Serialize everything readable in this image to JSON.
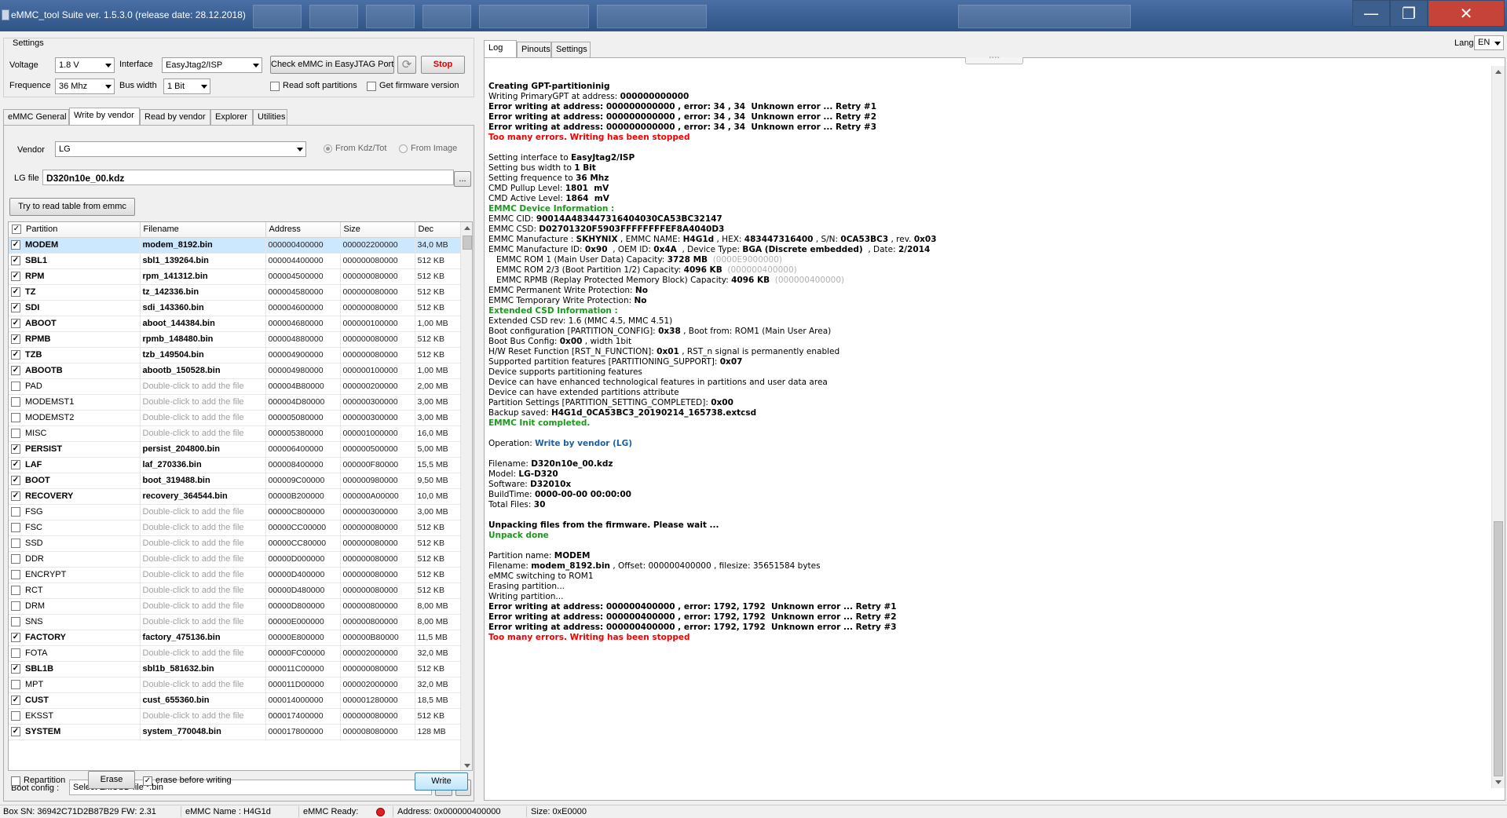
{
  "window": {
    "title": "eMMC_tool Suite  ver. 1.5.3.0 (release date: 28.12.2018)",
    "min": "—",
    "max": "❐",
    "close": "✕"
  },
  "settings": {
    "group_label": "Settings",
    "voltage_label": "Voltage",
    "voltage_value": "1.8 V",
    "interface_label": "Interface",
    "interface_value": "EasyJtag2/ISP",
    "check_button": "Check eMMC in EasyJTAG Port",
    "stop_button": "Stop",
    "frequence_label": "Frequence",
    "frequence_value": "36 Mhz",
    "buswidth_label": "Bus width",
    "buswidth_value": "1 Bit",
    "read_soft_label": "Read soft partitions",
    "get_fw_label": "Get firmware version"
  },
  "left_tabs": [
    "eMMC General",
    "Write by vendor",
    "Read by vendor",
    "Explorer",
    "Utilities"
  ],
  "vendor": {
    "label": "Vendor",
    "value": "LG",
    "from_kdz": "From Kdz/Tot",
    "from_image": "From Image",
    "file_label": "LG file",
    "file_value": "D320n10e_00.kdz",
    "browse": "...",
    "read_table_button": "Try to read table from emmc"
  },
  "partition_table": {
    "columns": [
      "Partition",
      "Filename",
      "Address",
      "Size",
      "Dec"
    ],
    "header_checked": "✓",
    "rows": [
      {
        "check": "✓",
        "name": "MODEM",
        "file": "modem_8192.bin",
        "addr": "000000400000",
        "size": "000002200000",
        "dec": "34,0 MB"
      },
      {
        "check": "✓",
        "name": "SBL1",
        "file": "sbl1_139264.bin",
        "addr": "000004400000",
        "size": "000000080000",
        "dec": "512 KB"
      },
      {
        "check": "✓",
        "name": "RPM",
        "file": "rpm_141312.bin",
        "addr": "000004500000",
        "size": "000000080000",
        "dec": "512 KB"
      },
      {
        "check": "✓",
        "name": "TZ",
        "file": "tz_142336.bin",
        "addr": "000004580000",
        "size": "000000080000",
        "dec": "512 KB"
      },
      {
        "check": "✓",
        "name": "SDI",
        "file": "sdi_143360.bin",
        "addr": "000004600000",
        "size": "000000080000",
        "dec": "512 KB"
      },
      {
        "check": "✓",
        "name": "ABOOT",
        "file": "aboot_144384.bin",
        "addr": "000004680000",
        "size": "000000100000",
        "dec": "1,00 MB"
      },
      {
        "check": "✓",
        "name": "RPMB",
        "file": "rpmb_148480.bin",
        "addr": "000004880000",
        "size": "000000080000",
        "dec": "512 KB"
      },
      {
        "check": "✓",
        "name": "TZB",
        "file": "tzb_149504.bin",
        "addr": "000004900000",
        "size": "000000080000",
        "dec": "512 KB"
      },
      {
        "check": "✓",
        "name": "ABOOTB",
        "file": "abootb_150528.bin",
        "addr": "000004980000",
        "size": "000000100000",
        "dec": "1,00 MB"
      },
      {
        "check": "",
        "name": "PAD",
        "file": "Double-click to add the file",
        "addr": "000004B80000",
        "size": "000000200000",
        "dec": "2,00 MB"
      },
      {
        "check": "",
        "name": "MODEMST1",
        "file": "Double-click to add the file",
        "addr": "000004D80000",
        "size": "000000300000",
        "dec": "3,00 MB"
      },
      {
        "check": "",
        "name": "MODEMST2",
        "file": "Double-click to add the file",
        "addr": "000005080000",
        "size": "000000300000",
        "dec": "3,00 MB"
      },
      {
        "check": "",
        "name": "MISC",
        "file": "Double-click to add the file",
        "addr": "000005380000",
        "size": "000001000000",
        "dec": "16,0 MB"
      },
      {
        "check": "✓",
        "name": "PERSIST",
        "file": "persist_204800.bin",
        "addr": "000006400000",
        "size": "000000500000",
        "dec": "5,00 MB"
      },
      {
        "check": "✓",
        "name": "LAF",
        "file": "laf_270336.bin",
        "addr": "000008400000",
        "size": "000000F80000",
        "dec": "15,5 MB"
      },
      {
        "check": "✓",
        "name": "BOOT",
        "file": "boot_319488.bin",
        "addr": "000009C00000",
        "size": "000000980000",
        "dec": "9,50 MB"
      },
      {
        "check": "✓",
        "name": "RECOVERY",
        "file": "recovery_364544.bin",
        "addr": "00000B200000",
        "size": "000000A00000",
        "dec": "10,0 MB"
      },
      {
        "check": "",
        "name": "FSG",
        "file": "Double-click to add the file",
        "addr": "00000C800000",
        "size": "000000300000",
        "dec": "3,00 MB"
      },
      {
        "check": "",
        "name": "FSC",
        "file": "Double-click to add the file",
        "addr": "00000CC00000",
        "size": "000000080000",
        "dec": "512 KB"
      },
      {
        "check": "",
        "name": "SSD",
        "file": "Double-click to add the file",
        "addr": "00000CC80000",
        "size": "000000080000",
        "dec": "512 KB"
      },
      {
        "check": "",
        "name": "DDR",
        "file": "Double-click to add the file",
        "addr": "00000D000000",
        "size": "000000080000",
        "dec": "512 KB"
      },
      {
        "check": "",
        "name": "ENCRYPT",
        "file": "Double-click to add the file",
        "addr": "00000D400000",
        "size": "000000080000",
        "dec": "512 KB"
      },
      {
        "check": "",
        "name": "RCT",
        "file": "Double-click to add the file",
        "addr": "00000D480000",
        "size": "000000080000",
        "dec": "512 KB"
      },
      {
        "check": "",
        "name": "DRM",
        "file": "Double-click to add the file",
        "addr": "00000D800000",
        "size": "000000800000",
        "dec": "8,00 MB"
      },
      {
        "check": "",
        "name": "SNS",
        "file": "Double-click to add the file",
        "addr": "00000E000000",
        "size": "000000800000",
        "dec": "8,00 MB"
      },
      {
        "check": "✓",
        "name": "FACTORY",
        "file": "factory_475136.bin",
        "addr": "00000E800000",
        "size": "000000B80000",
        "dec": "11,5 MB"
      },
      {
        "check": "",
        "name": "FOTA",
        "file": "Double-click to add the file",
        "addr": "00000FC00000",
        "size": "000002000000",
        "dec": "32,0 MB"
      },
      {
        "check": "✓",
        "name": "SBL1B",
        "file": "sbl1b_581632.bin",
        "addr": "000011C00000",
        "size": "000000080000",
        "dec": "512 KB"
      },
      {
        "check": "",
        "name": "MPT",
        "file": "Double-click to add the file",
        "addr": "000011D00000",
        "size": "000002000000",
        "dec": "32,0 MB"
      },
      {
        "check": "✓",
        "name": "CUST",
        "file": "cust_655360.bin",
        "addr": "000014000000",
        "size": "000001280000",
        "dec": "18,5 MB"
      },
      {
        "check": "",
        "name": "EKSST",
        "file": "Double-click to add the file",
        "addr": "000017400000",
        "size": "000000080000",
        "dec": "512 KB"
      },
      {
        "check": "✓",
        "name": "SYSTEM",
        "file": "system_770048.bin",
        "addr": "000017800000",
        "size": "000008080000",
        "dec": "128 MB"
      }
    ]
  },
  "bottom": {
    "boot_config_label": "Boot config :",
    "boot_config_value": "Select ExtCSD file *.bin",
    "dots": "...",
    "clear": "X",
    "repartition": "Repartition",
    "erase": "Erase",
    "erase_check": "✓",
    "erase_before": "erase before writing",
    "write": "Write"
  },
  "right_tabs": [
    "Log",
    "Pinouts",
    "Settings"
  ],
  "lang": {
    "label": "Lang",
    "value": "EN"
  },
  "log_lines": [
    [
      {
        "t": "Creating GPT-partitioninig",
        "c": "b"
      }
    ],
    [
      {
        "t": "Writing PrimaryGPT at address: "
      },
      {
        "t": "000000000000",
        "c": "b"
      }
    ],
    [
      {
        "t": "Error writing at address: 000000000000 , error: 34 , 34  Unknown error ... Retry #1",
        "c": "b"
      }
    ],
    [
      {
        "t": "Error writing at address: 000000000000 , error: 34 , 34  Unknown error ... Retry #2",
        "c": "b"
      }
    ],
    [
      {
        "t": "Error writing at address: 000000000000 , error: 34 , 34  Unknown error ... Retry #3",
        "c": "b"
      }
    ],
    [
      {
        "t": "Too many errors. Writing has been stopped",
        "c": "red"
      }
    ],
    [
      {
        "t": ""
      }
    ],
    [
      {
        "t": "Setting interface to "
      },
      {
        "t": "EasyJtag2/ISP",
        "c": "b"
      }
    ],
    [
      {
        "t": "Setting bus width to "
      },
      {
        "t": "1 Bit",
        "c": "b"
      }
    ],
    [
      {
        "t": "Setting frequence to "
      },
      {
        "t": "36 Mhz",
        "c": "b"
      }
    ],
    [
      {
        "t": "CMD Pullup Level: "
      },
      {
        "t": "1801  mV",
        "c": "b"
      }
    ],
    [
      {
        "t": "CMD Active Level: "
      },
      {
        "t": "1864  mV",
        "c": "b"
      }
    ],
    [
      {
        "t": "EMMC Device Information :",
        "c": "green"
      }
    ],
    [
      {
        "t": "EMMC CID: "
      },
      {
        "t": "90014A483447316404030CA53BC32147",
        "c": "b"
      }
    ],
    [
      {
        "t": "EMMC CSD: "
      },
      {
        "t": "D02701320F5903FFFFFFFFEF8A4040D3",
        "c": "b"
      }
    ],
    [
      {
        "t": "EMMC Manufacture : "
      },
      {
        "t": "SKHYNIX",
        "c": "b"
      },
      {
        "t": " , EMMC NAME: "
      },
      {
        "t": "H4G1d",
        "c": "b"
      },
      {
        "t": " , HEX: "
      },
      {
        "t": "483447316400",
        "c": "b"
      },
      {
        "t": " , S/N: "
      },
      {
        "t": "0CA53BC3",
        "c": "b"
      },
      {
        "t": " , rev. "
      },
      {
        "t": "0x03",
        "c": "b"
      }
    ],
    [
      {
        "t": "EMMC Manufacture ID: "
      },
      {
        "t": "0x90",
        "c": "b"
      },
      {
        "t": "  , OEM ID: "
      },
      {
        "t": "0x4A",
        "c": "b"
      },
      {
        "t": "  , Device Type: "
      },
      {
        "t": "BGA (Discrete embedded)",
        "c": "b"
      },
      {
        "t": "  , Date: "
      },
      {
        "t": "2/2014",
        "c": "b"
      }
    ],
    [
      {
        "t": "   EMMC ROM 1 (Main User Data) Capacity: "
      },
      {
        "t": "3728 MB",
        "c": "b"
      },
      {
        "t": "  (0000E9000000)",
        "c": "gray"
      }
    ],
    [
      {
        "t": "   EMMC ROM 2/3 (Boot Partition 1/2) Capacity: "
      },
      {
        "t": "4096 KB",
        "c": "b"
      },
      {
        "t": "  (000000400000)",
        "c": "gray"
      }
    ],
    [
      {
        "t": "   EMMC RPMB (Replay Protected Memory Block) Capacity: "
      },
      {
        "t": "4096 KB",
        "c": "b"
      },
      {
        "t": "  (000000400000)",
        "c": "gray"
      }
    ],
    [
      {
        "t": "EMMC Permanent Write Protection: "
      },
      {
        "t": "No",
        "c": "b"
      }
    ],
    [
      {
        "t": "EMMC Temporary Write Protection: "
      },
      {
        "t": "No",
        "c": "b"
      }
    ],
    [
      {
        "t": "Extended CSD Information :",
        "c": "green"
      }
    ],
    [
      {
        "t": "Extended CSD rev: 1.6 (MMC 4.5, MMC 4.51)"
      }
    ],
    [
      {
        "t": "Boot configuration [PARTITION_CONFIG]: "
      },
      {
        "t": "0x38",
        "c": "b"
      },
      {
        "t": " , Boot from: ROM1 (Main User Area)"
      }
    ],
    [
      {
        "t": "Boot Bus Config: "
      },
      {
        "t": "0x00",
        "c": "b"
      },
      {
        "t": " , width 1bit"
      }
    ],
    [
      {
        "t": "H/W Reset Function [RST_N_FUNCTION]: "
      },
      {
        "t": "0x01",
        "c": "b"
      },
      {
        "t": " , RST_n signal is permanently enabled"
      }
    ],
    [
      {
        "t": "Supported partition features [PARTITIONING_SUPPORT]: "
      },
      {
        "t": "0x07",
        "c": "b"
      }
    ],
    [
      {
        "t": "Device supports partitioning features"
      }
    ],
    [
      {
        "t": "Device can have enhanced technological features in partitions and user data area"
      }
    ],
    [
      {
        "t": "Device can have extended partitions attribute"
      }
    ],
    [
      {
        "t": "Partition Settings [PARTITION_SETTING_COMPLETED]: "
      },
      {
        "t": "0x00",
        "c": "b"
      }
    ],
    [
      {
        "t": "Backup saved: "
      },
      {
        "t": "H4G1d_0CA53BC3_20190214_165738.extcsd",
        "c": "b"
      }
    ],
    [
      {
        "t": "EMMC Init completed.",
        "c": "green"
      }
    ],
    [
      {
        "t": ""
      }
    ],
    [
      {
        "t": "Operation: "
      },
      {
        "t": "Write by vendor (LG)",
        "c": "blue"
      }
    ],
    [
      {
        "t": ""
      }
    ],
    [
      {
        "t": "Filename: "
      },
      {
        "t": "D320n10e_00.kdz",
        "c": "b"
      }
    ],
    [
      {
        "t": "Model: "
      },
      {
        "t": "LG-D320",
        "c": "b"
      }
    ],
    [
      {
        "t": "Software: "
      },
      {
        "t": "D32010x",
        "c": "b"
      }
    ],
    [
      {
        "t": "BuildTime: "
      },
      {
        "t": "0000-00-00 00:00:00",
        "c": "b"
      }
    ],
    [
      {
        "t": "Total Files: "
      },
      {
        "t": "30",
        "c": "b"
      }
    ],
    [
      {
        "t": ""
      }
    ],
    [
      {
        "t": "Unpacking files from the firmware. Please wait ...",
        "c": "b"
      }
    ],
    [
      {
        "t": "Unpack done",
        "c": "green"
      }
    ],
    [
      {
        "t": ""
      }
    ],
    [
      {
        "t": "Partition name: "
      },
      {
        "t": "MODEM",
        "c": "b"
      }
    ],
    [
      {
        "t": "Filename: "
      },
      {
        "t": "modem_8192.bin",
        "c": "b"
      },
      {
        "t": " , Offset: 000000400000 , filesize: 35651584 bytes"
      }
    ],
    [
      {
        "t": "eMMC switching to ROM1"
      }
    ],
    [
      {
        "t": "Erasing partition..."
      }
    ],
    [
      {
        "t": "Writing partition..."
      }
    ],
    [
      {
        "t": "Error writing at address: 000000400000 , error: 1792, 1792  Unknown error ... Retry #1",
        "c": "b"
      }
    ],
    [
      {
        "t": "Error writing at address: 000000400000 , error: 1792, 1792  Unknown error ... Retry #2",
        "c": "b"
      }
    ],
    [
      {
        "t": "Error writing at address: 000000400000 , error: 1792, 1792  Unknown error ... Retry #3",
        "c": "b"
      }
    ],
    [
      {
        "t": "Too many errors. Writing has been stopped",
        "c": "red"
      }
    ]
  ],
  "status": {
    "box_sn": "Box SN:  36942C71D2B87B29  FW:  2.31",
    "emmc_name": "eMMC Name : H4G1d",
    "emmc_ready": "eMMC Ready:",
    "address": "Address: 0x000000400000",
    "size": "Size: 0xE0000"
  }
}
